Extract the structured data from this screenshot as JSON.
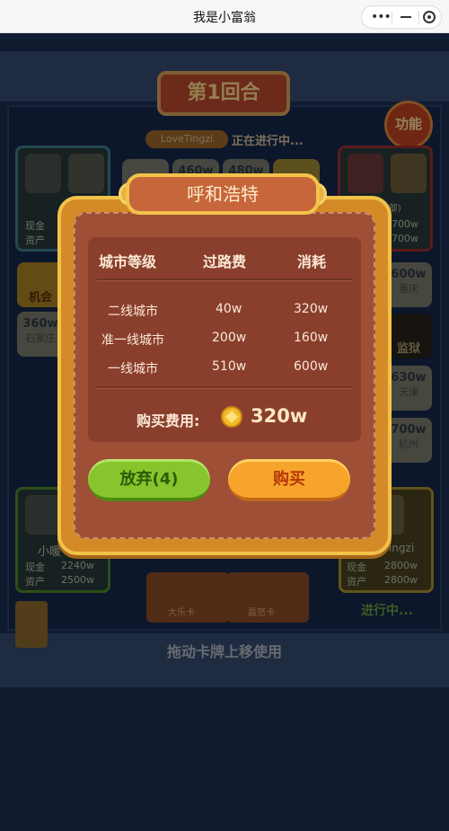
{
  "titlebar": {
    "title": "我是小富翁",
    "more": "•••"
  },
  "board": {
    "round": "第1回合",
    "current_user": "LoveTingzi",
    "current_status": "正在进行中...",
    "func_button": "功能",
    "top_tiles": [
      {
        "price": "460w"
      },
      {
        "price": "480w"
      }
    ],
    "left_tiles": [
      {
        "name": "机会"
      },
      {
        "price": "360w",
        "city": "石家庄"
      }
    ],
    "right_tiles": [
      {
        "price": "600w",
        "city": "重庆"
      },
      {
        "name": "监狱"
      },
      {
        "price": "630w",
        "city": "天津"
      },
      {
        "price": "700w",
        "city": "杭州"
      }
    ],
    "players": {
      "top_left": {
        "cash_label": "现金",
        "asset_label": "资产"
      },
      "top_right": {
        "name": "(五金批发部)",
        "cash": "2700w",
        "asset": "2700w"
      },
      "bottom_left": {
        "name": "小暖",
        "cash_label": "现金",
        "cash": "2240w",
        "asset_label": "资产",
        "asset": "2500w"
      },
      "bottom_right": {
        "name": "Tingzi",
        "cash_label": "现金",
        "cash": "2800w",
        "asset_label": "资产",
        "asset": "2800w",
        "status": "进行中..."
      }
    },
    "cards": [
      {
        "name": "大乐卡"
      },
      {
        "name": "震怒卡"
      }
    ],
    "hint": "拖动卡牌上移使用"
  },
  "modal": {
    "city_name": "呼和浩特",
    "headers": [
      "城市等级",
      "过路费",
      "消耗"
    ],
    "rows": [
      {
        "level": "二线城市",
        "toll": "40w",
        "cost": "320w"
      },
      {
        "level": "准一线城市",
        "toll": "200w",
        "cost": "160w"
      },
      {
        "level": "一线城市",
        "toll": "510w",
        "cost": "600w"
      }
    ],
    "purchase_label": "购买费用:",
    "purchase_cost": "320w",
    "give_up_button": "放弃(4)",
    "buy_button": "购买"
  }
}
